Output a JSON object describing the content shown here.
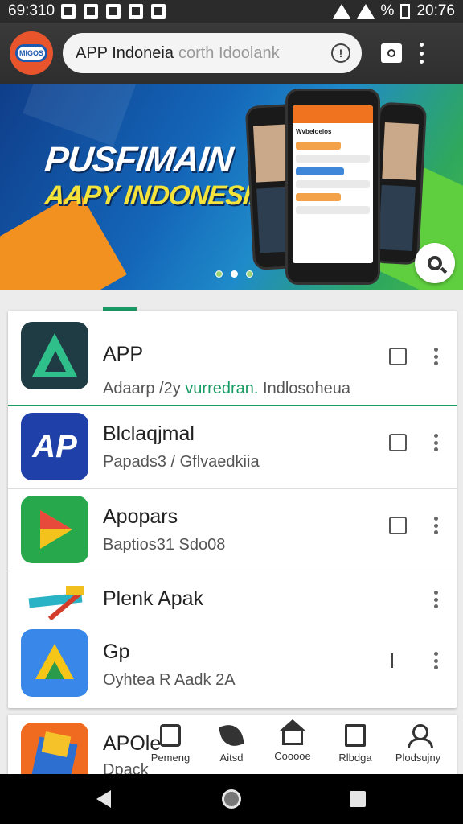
{
  "status_bar": {
    "time_left": "69:310",
    "time_right": "20:76",
    "battery_text": "%"
  },
  "top_bar": {
    "logo_text": "MIGOS",
    "search_query": "APP Indoneia",
    "search_placeholder": "corth Idoolank"
  },
  "banner": {
    "title_line1": "PUSFIMAIN",
    "title_line2": "AAPY INDONESIA",
    "phone_title": "Wvbeloelos",
    "slide_count": 3,
    "active_slide": 2
  },
  "apps": [
    {
      "title": "APP",
      "subtitle_pre": "Adaarp /2y ",
      "subtitle_link": "vurredran.",
      "subtitle_post": " Indlosoheua",
      "link_color": "#1a9a64"
    },
    {
      "title": "Blclaqjmal",
      "subtitle": "Papads3 / Gflvaedkiia",
      "icon_text": "AP"
    },
    {
      "title": "Apopars",
      "subtitle": "Baptios31 Sdo08"
    },
    {
      "title": "Plenk Apak"
    },
    {
      "title": "Gp",
      "subtitle": "Oyhtea R Aadk 2A"
    }
  ],
  "partial_app": {
    "title": "APOle",
    "subtitle": "Dpack"
  },
  "bottom_nav": [
    {
      "label": "Pemeng",
      "icon": "home-box-icon"
    },
    {
      "label": "Aitsd",
      "icon": "leaf-icon"
    },
    {
      "label": "Cooooe",
      "icon": "house-icon"
    },
    {
      "label": "Rlbdga",
      "icon": "document-icon"
    },
    {
      "label": "Plodsujny",
      "icon": "person-icon"
    }
  ],
  "colors": {
    "accent_green": "#1a9a64",
    "top_bar_bg": "#2e2e2e",
    "logo_orange": "#e8542c"
  }
}
